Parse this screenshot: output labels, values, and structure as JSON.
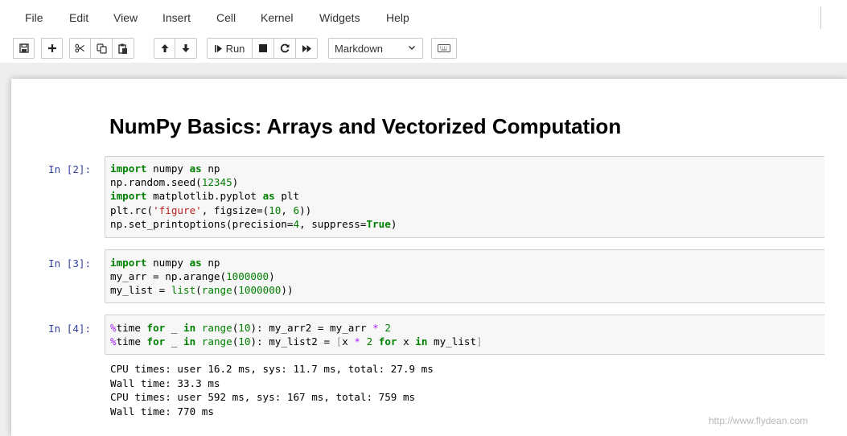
{
  "menu": {
    "items": [
      "File",
      "Edit",
      "View",
      "Insert",
      "Cell",
      "Kernel",
      "Widgets",
      "Help"
    ]
  },
  "toolbar": {
    "icons": [
      "save-icon",
      "plus-icon",
      "cut-icon",
      "copy-icon",
      "paste-icon",
      "arrow-up-icon",
      "arrow-down-icon",
      "step-forward-icon",
      "stop-icon",
      "restart-icon",
      "fast-forward-icon",
      "keyboard-icon"
    ],
    "run_label": "Run",
    "cell_type": "Markdown"
  },
  "notebook": {
    "heading": "NumPy Basics: Arrays and Vectorized Computation",
    "cells": [
      {
        "prompt": "In [2]:",
        "lines": [
          "import numpy as np",
          "np.random.seed(12345)",
          "import matplotlib.pyplot as plt",
          "plt.rc('figure', figsize=(10, 6))",
          "np.set_printoptions(precision=4, suppress=True)"
        ]
      },
      {
        "prompt": "In [3]:",
        "lines": [
          "import numpy as np",
          "my_arr = np.arange(1000000)",
          "my_list = list(range(1000000))"
        ]
      },
      {
        "prompt": "In [4]:",
        "lines": [
          "%time for _ in range(10): my_arr2 = my_arr * 2",
          "%time for _ in range(10): my_list2 = [x * 2 for x in my_list]"
        ],
        "output": [
          "CPU times: user 16.2 ms, sys: 11.7 ms, total: 27.9 ms",
          "Wall time: 33.3 ms",
          "CPU times: user 592 ms, sys: 167 ms, total: 759 ms",
          "Wall time: 770 ms"
        ]
      }
    ]
  },
  "watermark": "http://www.flydean.com",
  "colors": {
    "keyword": "#008000",
    "string": "#ba2121",
    "operator": "#aa22ff",
    "prompt": "#303f9f"
  }
}
